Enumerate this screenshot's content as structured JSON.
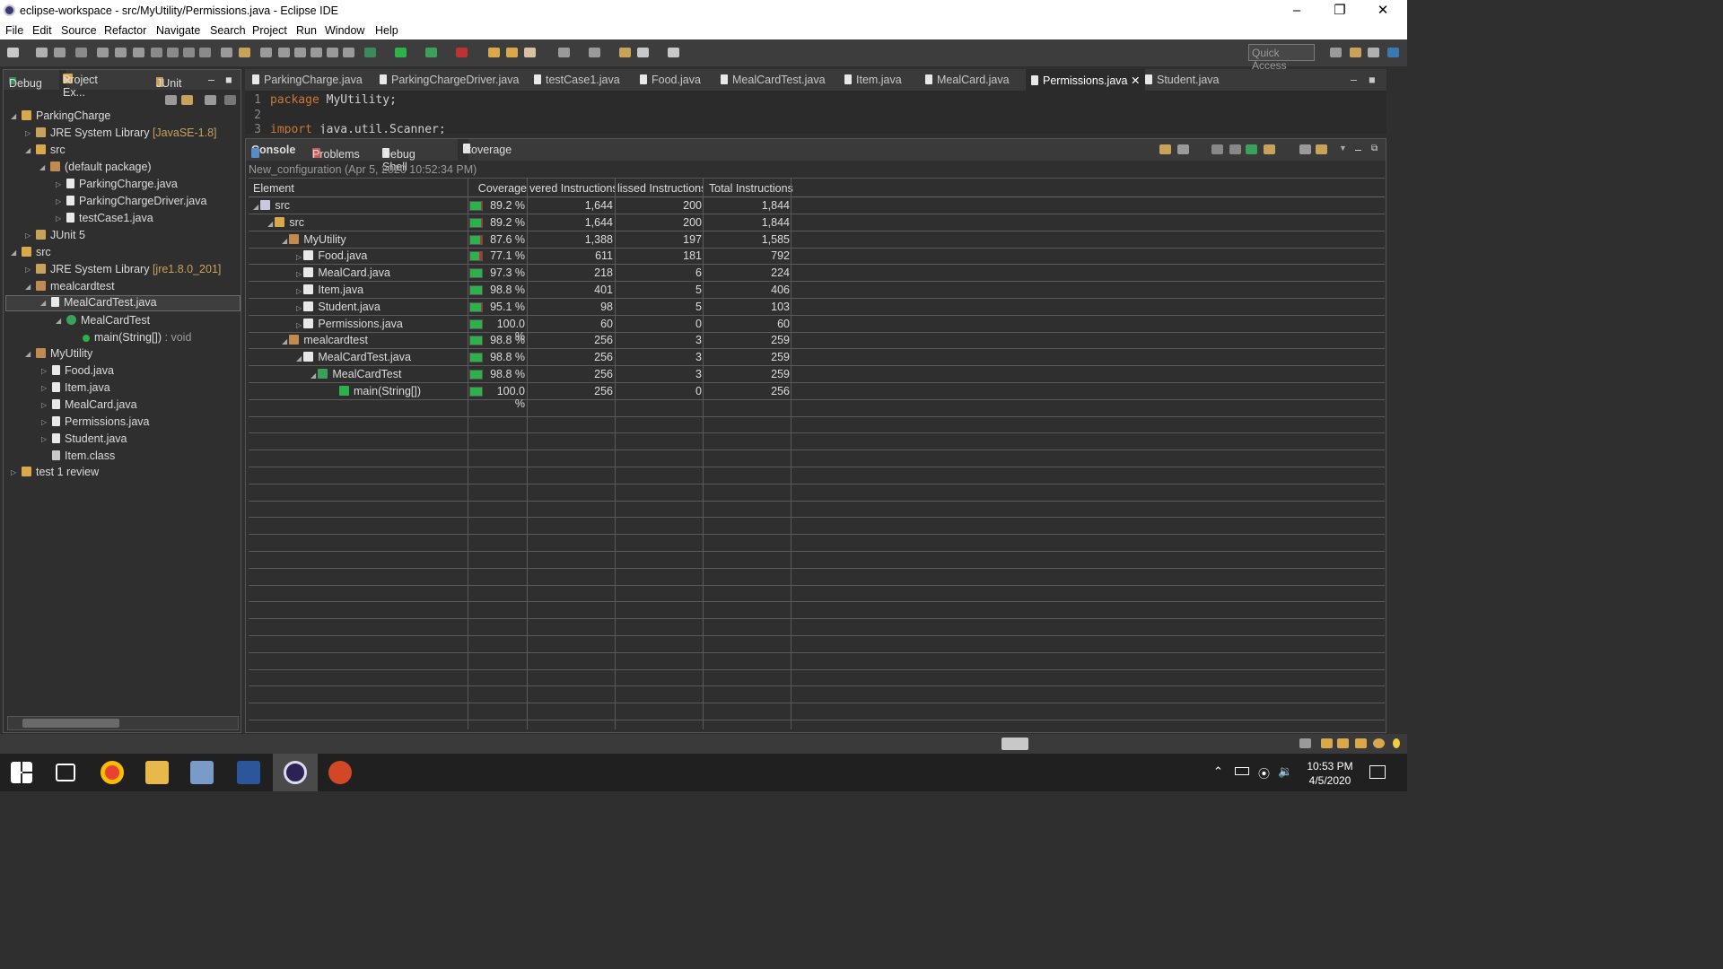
{
  "window": {
    "title": "eclipse-workspace - src/MyUtility/Permissions.java - Eclipse IDE"
  },
  "menu": [
    "File",
    "Edit",
    "Source",
    "Refactor",
    "Navigate",
    "Search",
    "Project",
    "Run",
    "Window",
    "Help"
  ],
  "quick_access": "Quick Access",
  "left_tabs": [
    "Debug",
    "Project Ex...",
    "JUnit"
  ],
  "tree": [
    {
      "label": "ParkingCharge",
      "icon": "project"
    },
    {
      "label": "JRE System Library",
      "deco": "[JavaSE-1.8]",
      "icon": "library"
    },
    {
      "label": "src",
      "icon": "folder"
    },
    {
      "label": "(default package)",
      "icon": "package"
    },
    {
      "label": "ParkingCharge.java",
      "icon": "java-file"
    },
    {
      "label": "ParkingChargeDriver.java",
      "icon": "java-file"
    },
    {
      "label": "testCase1.java",
      "icon": "java-file"
    },
    {
      "label": "JUnit 5",
      "icon": "library"
    },
    {
      "label": "src",
      "icon": "project"
    },
    {
      "label": "JRE System Library",
      "deco": "[jre1.8.0_201]",
      "icon": "library"
    },
    {
      "label": "mealcardtest",
      "icon": "package"
    },
    {
      "label": "MealCardTest.java",
      "icon": "java-file"
    },
    {
      "label": "MealCardTest",
      "icon": "class"
    },
    {
      "label": "main(String[])",
      "deco": ": void",
      "icon": "method"
    },
    {
      "label": "MyUtility",
      "icon": "package"
    },
    {
      "label": "Food.java",
      "icon": "java-file"
    },
    {
      "label": "Item.java",
      "icon": "java-file"
    },
    {
      "label": "MealCard.java",
      "icon": "java-file"
    },
    {
      "label": "Permissions.java",
      "icon": "java-file"
    },
    {
      "label": "Student.java",
      "icon": "java-file"
    },
    {
      "label": "Item.class",
      "icon": "class-file"
    },
    {
      "label": "test 1 review",
      "icon": "project"
    }
  ],
  "editor_tabs": [
    "ParkingCharge.java",
    "ParkingChargeDriver.java",
    "testCase1.java",
    "Food.java",
    "MealCardTest.java",
    "Item.java",
    "MealCard.java",
    "Permissions.java",
    "Student.java"
  ],
  "code": [
    {
      "n": "1",
      "kw": "package",
      "rest": " MyUtility;"
    },
    {
      "n": "2",
      "kw": "",
      "rest": ""
    },
    {
      "n": "3",
      "kw": "import",
      "rest": " java.util.Scanner;"
    }
  ],
  "bottom_tabs": [
    "Console",
    "Problems",
    "Debug Shell",
    "Coverage"
  ],
  "coverage": {
    "session": "New_configuration (Apr 5, 2020 10:52:34 PM)",
    "columns": [
      "Element",
      "Coverage",
      "vered Instructions",
      "lissed Instructions",
      "Total Instructions"
    ],
    "rows": [
      {
        "name": "src",
        "level": 0,
        "pct": "89.2 %",
        "covered": "1,644",
        "missed": "200",
        "total": "1,844",
        "frac": 0.892
      },
      {
        "name": "src",
        "level": 1,
        "pct": "89.2 %",
        "covered": "1,644",
        "missed": "200",
        "total": "1,844",
        "frac": 0.892
      },
      {
        "name": "MyUtility",
        "level": 2,
        "pct": "87.6 %",
        "covered": "1,388",
        "missed": "197",
        "total": "1,585",
        "frac": 0.876
      },
      {
        "name": "Food.java",
        "level": 3,
        "pct": "77.1 %",
        "covered": "611",
        "missed": "181",
        "total": "792",
        "frac": 0.771
      },
      {
        "name": "MealCard.java",
        "level": 3,
        "pct": "97.3 %",
        "covered": "218",
        "missed": "6",
        "total": "224",
        "frac": 0.973
      },
      {
        "name": "Item.java",
        "level": 3,
        "pct": "98.8 %",
        "covered": "401",
        "missed": "5",
        "total": "406",
        "frac": 0.988
      },
      {
        "name": "Student.java",
        "level": 3,
        "pct": "95.1 %",
        "covered": "98",
        "missed": "5",
        "total": "103",
        "frac": 0.951
      },
      {
        "name": "Permissions.java",
        "level": 3,
        "pct": "100.0 %",
        "covered": "60",
        "missed": "0",
        "total": "60",
        "frac": 1.0
      },
      {
        "name": "mealcardtest",
        "level": 2,
        "pct": "98.8 %",
        "covered": "256",
        "missed": "3",
        "total": "259",
        "frac": 0.988
      },
      {
        "name": "MealCardTest.java",
        "level": 3,
        "pct": "98.8 %",
        "covered": "256",
        "missed": "3",
        "total": "259",
        "frac": 0.988
      },
      {
        "name": "MealCardTest",
        "level": 4,
        "pct": "98.8 %",
        "covered": "256",
        "missed": "3",
        "total": "259",
        "frac": 0.988
      },
      {
        "name": "main(String[])",
        "level": 5,
        "pct": "100.0 %",
        "covered": "256",
        "missed": "0",
        "total": "256",
        "frac": 1.0
      }
    ]
  },
  "clock": {
    "time": "10:53 PM",
    "date": "4/5/2020"
  },
  "colors": {
    "covered": "#2db14a",
    "missed": "#b33333"
  }
}
